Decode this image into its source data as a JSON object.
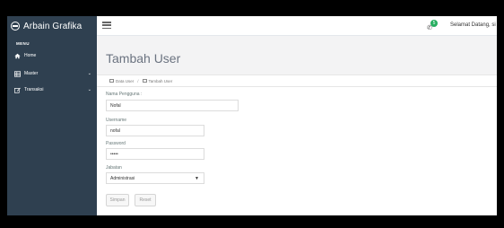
{
  "brand": {
    "name": "Arbain Grafika"
  },
  "header": {
    "notification_count": "5",
    "welcome_text": "Selamat Datang, si"
  },
  "sidebar": {
    "menu_title": "MENU",
    "items": [
      {
        "label": "Home",
        "icon": "home-icon",
        "has_children": false
      },
      {
        "label": "Master",
        "icon": "table-icon",
        "has_children": true
      },
      {
        "label": "Transaksi",
        "icon": "edit-icon",
        "has_children": true
      }
    ]
  },
  "main": {
    "title": "Tambah User",
    "breadcrumb": [
      "Data User",
      "Tambah User"
    ],
    "form": {
      "nama_label": "Nama Pengguna :",
      "nama_value": "Nofal",
      "username_label": "Username",
      "username_value": "nofal",
      "password_label": "Password",
      "password_value": "•••••",
      "jabatan_label": "Jabatan",
      "jabatan_value": "Administrasi",
      "simpan_label": "Simpan",
      "reset_label": "Reset"
    }
  },
  "colors": {
    "sidebar_bg": "#2f4050",
    "notification_badge": "#27ae60",
    "content_bg": "#f3f3f4"
  }
}
